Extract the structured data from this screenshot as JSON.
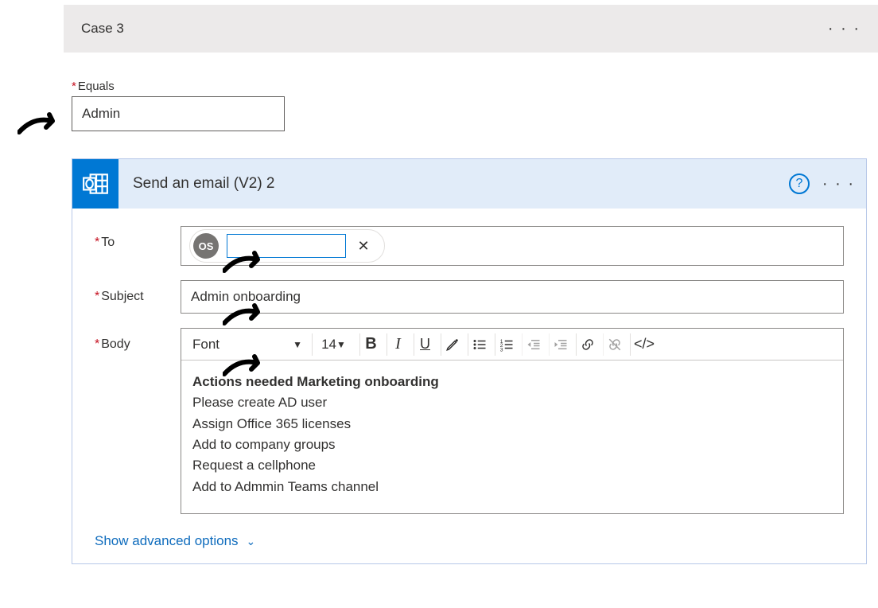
{
  "case": {
    "title": "Case 3"
  },
  "equals": {
    "label": "Equals",
    "value": "Admin"
  },
  "email_card": {
    "title": "Send an email (V2) 2",
    "fields": {
      "to": {
        "label": "To",
        "pill_initials": "OS",
        "input_value": ""
      },
      "subject": {
        "label": "Subject",
        "value": "Admin onboarding"
      },
      "body": {
        "label": "Body",
        "font_name": "Font",
        "font_size": "14",
        "heading": "Actions needed Marketing onboarding",
        "lines": [
          "Please create AD user",
          "Assign Office 365 licenses",
          "Add to company groups",
          "Request a cellphone",
          "Add to Admmin Teams channel"
        ]
      }
    },
    "advanced_link": "Show advanced options"
  }
}
